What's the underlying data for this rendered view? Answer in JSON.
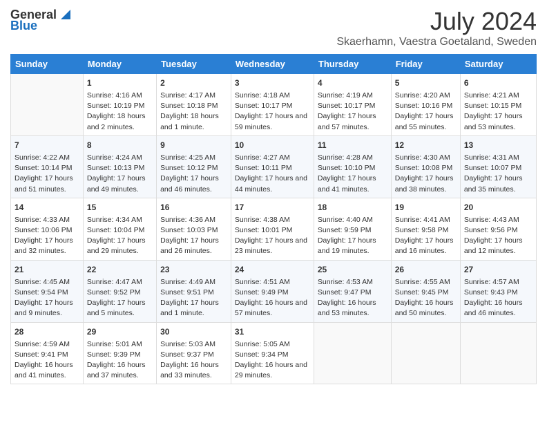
{
  "logo": {
    "text_general": "General",
    "text_blue": "Blue"
  },
  "header": {
    "month_year": "July 2024",
    "location": "Skaerhamn, Vaestra Goetaland, Sweden"
  },
  "days_of_week": [
    "Sunday",
    "Monday",
    "Tuesday",
    "Wednesday",
    "Thursday",
    "Friday",
    "Saturday"
  ],
  "weeks": [
    {
      "cells": [
        {
          "day": "",
          "empty": true
        },
        {
          "day": "1",
          "sunrise": "Sunrise: 4:16 AM",
          "sunset": "Sunset: 10:19 PM",
          "daylight": "Daylight: 18 hours and 2 minutes."
        },
        {
          "day": "2",
          "sunrise": "Sunrise: 4:17 AM",
          "sunset": "Sunset: 10:18 PM",
          "daylight": "Daylight: 18 hours and 1 minute."
        },
        {
          "day": "3",
          "sunrise": "Sunrise: 4:18 AM",
          "sunset": "Sunset: 10:17 PM",
          "daylight": "Daylight: 17 hours and 59 minutes."
        },
        {
          "day": "4",
          "sunrise": "Sunrise: 4:19 AM",
          "sunset": "Sunset: 10:17 PM",
          "daylight": "Daylight: 17 hours and 57 minutes."
        },
        {
          "day": "5",
          "sunrise": "Sunrise: 4:20 AM",
          "sunset": "Sunset: 10:16 PM",
          "daylight": "Daylight: 17 hours and 55 minutes."
        },
        {
          "day": "6",
          "sunrise": "Sunrise: 4:21 AM",
          "sunset": "Sunset: 10:15 PM",
          "daylight": "Daylight: 17 hours and 53 minutes."
        }
      ]
    },
    {
      "cells": [
        {
          "day": "7",
          "sunrise": "Sunrise: 4:22 AM",
          "sunset": "Sunset: 10:14 PM",
          "daylight": "Daylight: 17 hours and 51 minutes."
        },
        {
          "day": "8",
          "sunrise": "Sunrise: 4:24 AM",
          "sunset": "Sunset: 10:13 PM",
          "daylight": "Daylight: 17 hours and 49 minutes."
        },
        {
          "day": "9",
          "sunrise": "Sunrise: 4:25 AM",
          "sunset": "Sunset: 10:12 PM",
          "daylight": "Daylight: 17 hours and 46 minutes."
        },
        {
          "day": "10",
          "sunrise": "Sunrise: 4:27 AM",
          "sunset": "Sunset: 10:11 PM",
          "daylight": "Daylight: 17 hours and 44 minutes."
        },
        {
          "day": "11",
          "sunrise": "Sunrise: 4:28 AM",
          "sunset": "Sunset: 10:10 PM",
          "daylight": "Daylight: 17 hours and 41 minutes."
        },
        {
          "day": "12",
          "sunrise": "Sunrise: 4:30 AM",
          "sunset": "Sunset: 10:08 PM",
          "daylight": "Daylight: 17 hours and 38 minutes."
        },
        {
          "day": "13",
          "sunrise": "Sunrise: 4:31 AM",
          "sunset": "Sunset: 10:07 PM",
          "daylight": "Daylight: 17 hours and 35 minutes."
        }
      ]
    },
    {
      "cells": [
        {
          "day": "14",
          "sunrise": "Sunrise: 4:33 AM",
          "sunset": "Sunset: 10:06 PM",
          "daylight": "Daylight: 17 hours and 32 minutes."
        },
        {
          "day": "15",
          "sunrise": "Sunrise: 4:34 AM",
          "sunset": "Sunset: 10:04 PM",
          "daylight": "Daylight: 17 hours and 29 minutes."
        },
        {
          "day": "16",
          "sunrise": "Sunrise: 4:36 AM",
          "sunset": "Sunset: 10:03 PM",
          "daylight": "Daylight: 17 hours and 26 minutes."
        },
        {
          "day": "17",
          "sunrise": "Sunrise: 4:38 AM",
          "sunset": "Sunset: 10:01 PM",
          "daylight": "Daylight: 17 hours and 23 minutes."
        },
        {
          "day": "18",
          "sunrise": "Sunrise: 4:40 AM",
          "sunset": "Sunset: 9:59 PM",
          "daylight": "Daylight: 17 hours and 19 minutes."
        },
        {
          "day": "19",
          "sunrise": "Sunrise: 4:41 AM",
          "sunset": "Sunset: 9:58 PM",
          "daylight": "Daylight: 17 hours and 16 minutes."
        },
        {
          "day": "20",
          "sunrise": "Sunrise: 4:43 AM",
          "sunset": "Sunset: 9:56 PM",
          "daylight": "Daylight: 17 hours and 12 minutes."
        }
      ]
    },
    {
      "cells": [
        {
          "day": "21",
          "sunrise": "Sunrise: 4:45 AM",
          "sunset": "Sunset: 9:54 PM",
          "daylight": "Daylight: 17 hours and 9 minutes."
        },
        {
          "day": "22",
          "sunrise": "Sunrise: 4:47 AM",
          "sunset": "Sunset: 9:52 PM",
          "daylight": "Daylight: 17 hours and 5 minutes."
        },
        {
          "day": "23",
          "sunrise": "Sunrise: 4:49 AM",
          "sunset": "Sunset: 9:51 PM",
          "daylight": "Daylight: 17 hours and 1 minute."
        },
        {
          "day": "24",
          "sunrise": "Sunrise: 4:51 AM",
          "sunset": "Sunset: 9:49 PM",
          "daylight": "Daylight: 16 hours and 57 minutes."
        },
        {
          "day": "25",
          "sunrise": "Sunrise: 4:53 AM",
          "sunset": "Sunset: 9:47 PM",
          "daylight": "Daylight: 16 hours and 53 minutes."
        },
        {
          "day": "26",
          "sunrise": "Sunrise: 4:55 AM",
          "sunset": "Sunset: 9:45 PM",
          "daylight": "Daylight: 16 hours and 50 minutes."
        },
        {
          "day": "27",
          "sunrise": "Sunrise: 4:57 AM",
          "sunset": "Sunset: 9:43 PM",
          "daylight": "Daylight: 16 hours and 46 minutes."
        }
      ]
    },
    {
      "cells": [
        {
          "day": "28",
          "sunrise": "Sunrise: 4:59 AM",
          "sunset": "Sunset: 9:41 PM",
          "daylight": "Daylight: 16 hours and 41 minutes."
        },
        {
          "day": "29",
          "sunrise": "Sunrise: 5:01 AM",
          "sunset": "Sunset: 9:39 PM",
          "daylight": "Daylight: 16 hours and 37 minutes."
        },
        {
          "day": "30",
          "sunrise": "Sunrise: 5:03 AM",
          "sunset": "Sunset: 9:37 PM",
          "daylight": "Daylight: 16 hours and 33 minutes."
        },
        {
          "day": "31",
          "sunrise": "Sunrise: 5:05 AM",
          "sunset": "Sunset: 9:34 PM",
          "daylight": "Daylight: 16 hours and 29 minutes."
        },
        {
          "day": "",
          "empty": true
        },
        {
          "day": "",
          "empty": true
        },
        {
          "day": "",
          "empty": true
        }
      ]
    }
  ]
}
